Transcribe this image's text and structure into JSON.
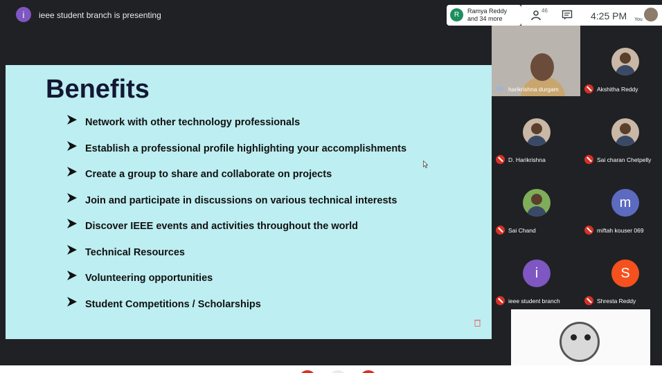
{
  "topbar": {
    "presenter_initial": "i",
    "presenting_text": "ieee student branch is presenting",
    "people_chip": {
      "initial": "R",
      "line1": "Ramya Reddy",
      "line2": "and 34 more"
    },
    "participant_count": "46",
    "time": "4:25 PM",
    "you_label": "You"
  },
  "slide": {
    "title": "Benefits",
    "bullets": [
      "Network with other technology professionals",
      "Establish a professional profile highlighting your accomplishments",
      "Create a group to share and collaborate on projects",
      "Join and participate in discussions on various technical interests",
      "Discover IEEE events and activities throughout the world",
      "Technical Resources",
      "Volunteering opportunities",
      "Student Competitions / Scholarships"
    ]
  },
  "participants": {
    "active": "harikrishna durgam",
    "tiles": [
      {
        "name": "Akshitha Reddy",
        "avatar": "photo"
      },
      {
        "name": "D. Harikrishna",
        "avatar": "photo"
      },
      {
        "name": "Sai charan Chetpelly",
        "avatar": "photo"
      },
      {
        "name": "Sai Chand",
        "avatar": "photo"
      },
      {
        "name": "miftah kouser 069",
        "initial": "m",
        "color": "#5c6bc0"
      },
      {
        "name": "ieee student branch",
        "initial": "i",
        "color": "#7e57c2"
      },
      {
        "name": "Shresta Reddy",
        "initial": "S",
        "color": "#f4511e"
      }
    ]
  },
  "colors": {
    "slide_bg": "#bdeef1",
    "title": "#131733",
    "mic_off": "#d93025"
  }
}
